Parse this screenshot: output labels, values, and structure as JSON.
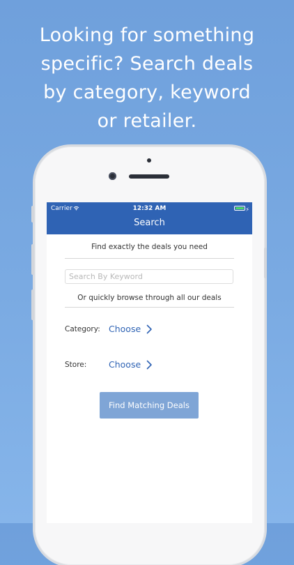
{
  "headline": {
    "line1": "Looking for something",
    "line2": "specific? Search deals",
    "line3": "by category, keyword",
    "line4": "or retailer."
  },
  "status_bar": {
    "carrier": "Carrier",
    "time": "12:32 AM",
    "battery_level": 1.0,
    "battery_color": "#4cd964"
  },
  "nav": {
    "title": "Search",
    "color": "#2f63b4"
  },
  "search": {
    "intro": "Find exactly the deals you need",
    "placeholder": "Search By Keyword",
    "value": "",
    "browse_text": "Or quickly browse through all our deals"
  },
  "filters": {
    "category_label": "Category:",
    "category_value": "Choose",
    "store_label": "Store:",
    "store_value": "Choose"
  },
  "actions": {
    "find_label": "Find Matching Deals",
    "find_color": "#7fa5d6"
  },
  "icons": [
    "wifi-icon",
    "battery-icon",
    "bolt-icon",
    "chevron-right-icon"
  ]
}
